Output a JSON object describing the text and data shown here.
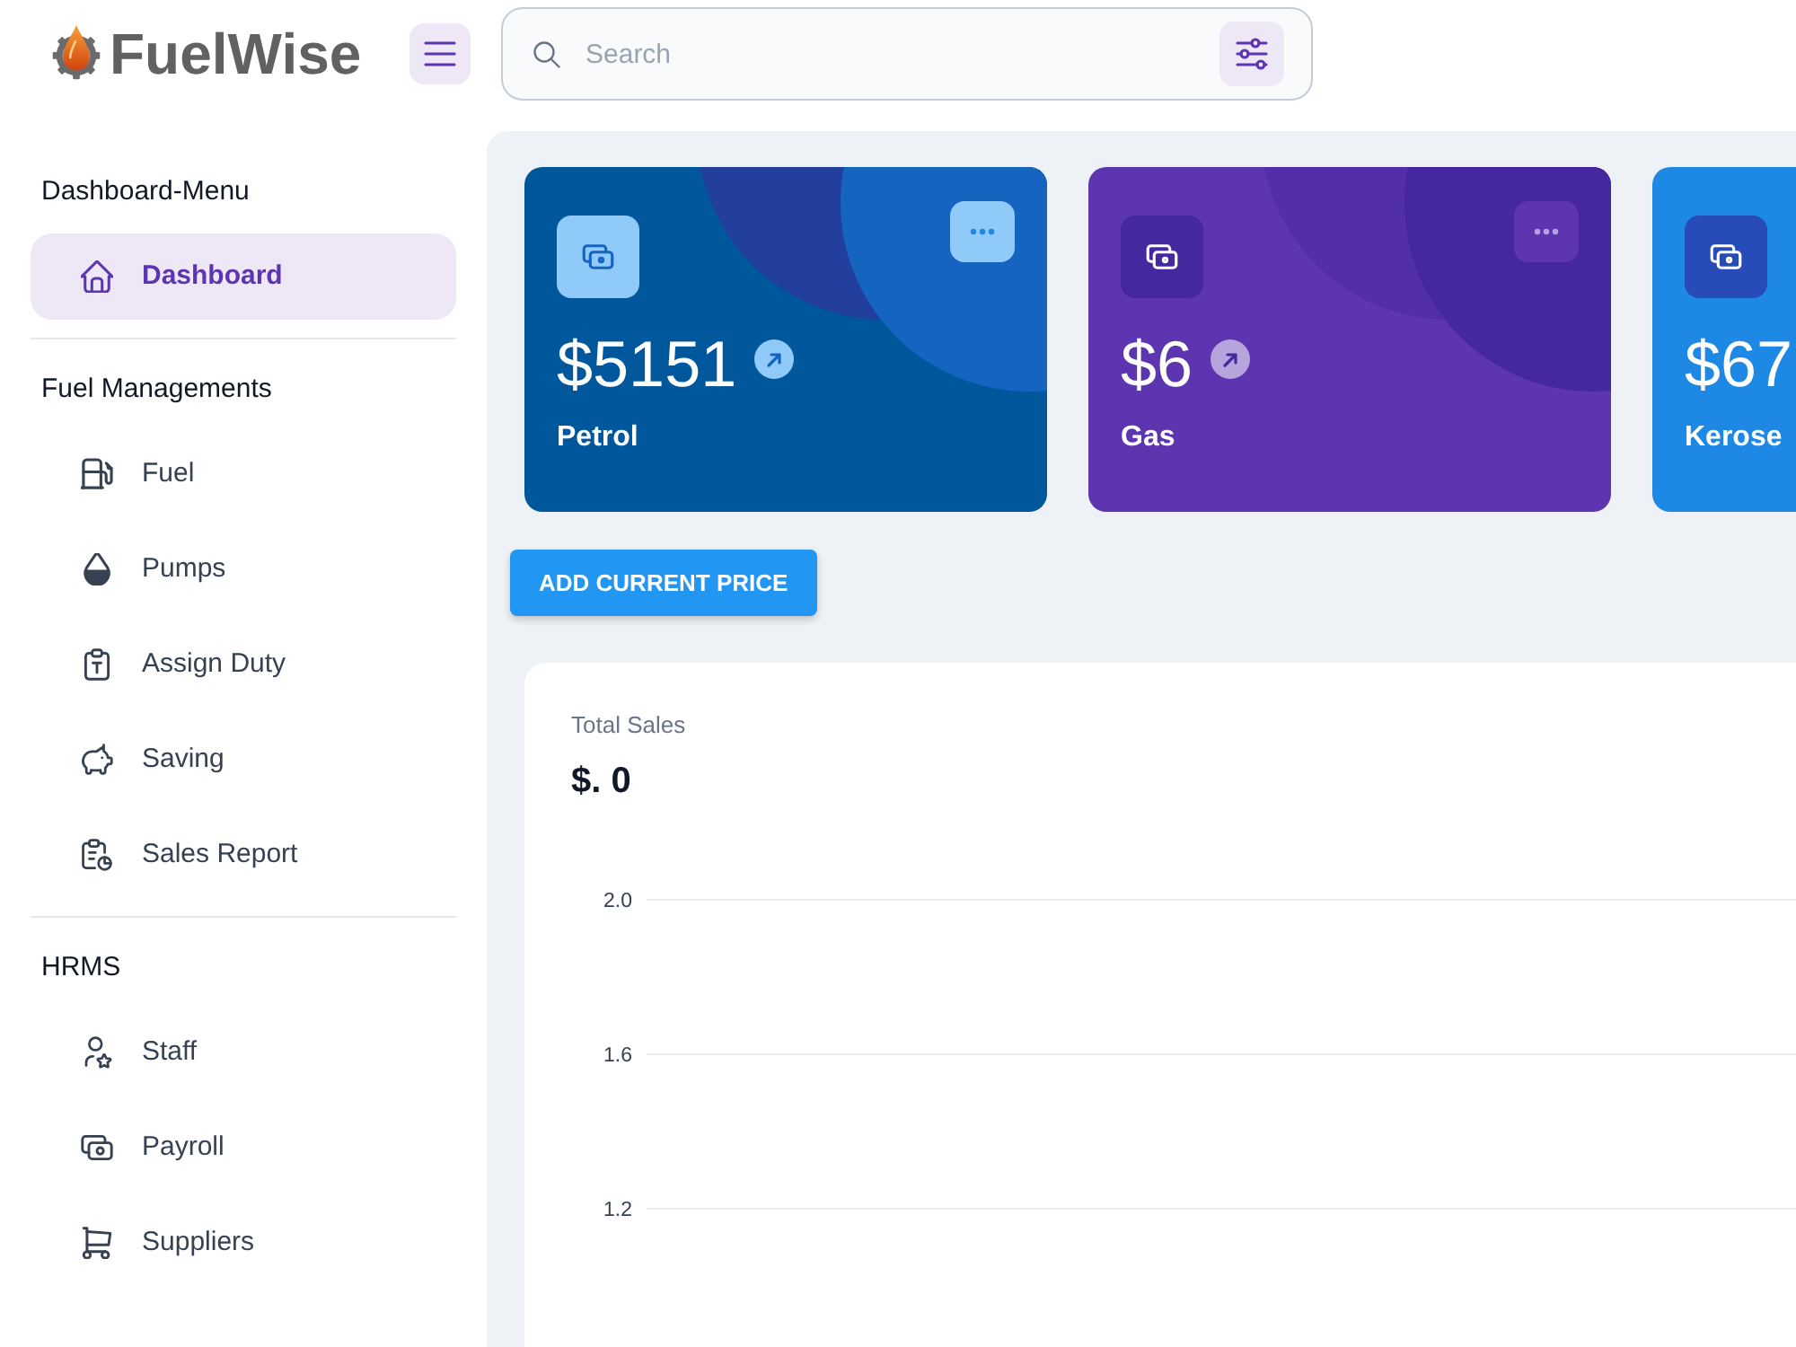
{
  "header": {
    "brand": "FuelWise",
    "search": {
      "placeholder": "Search"
    }
  },
  "sidebar": {
    "sections": [
      {
        "title": "Dashboard-Menu",
        "items": [
          {
            "label": "Dashboard",
            "selected": true
          }
        ]
      },
      {
        "title": "Fuel Managements",
        "items": [
          {
            "label": "Fuel",
            "selected": false
          },
          {
            "label": "Pumps",
            "selected": false
          },
          {
            "label": "Assign Duty",
            "selected": false
          },
          {
            "label": "Saving",
            "selected": false
          },
          {
            "label": "Sales Report",
            "selected": false
          }
        ]
      },
      {
        "title": "HRMS",
        "items": [
          {
            "label": "Staff",
            "selected": false
          },
          {
            "label": "Payroll",
            "selected": false
          },
          {
            "label": "Suppliers",
            "selected": false
          }
        ]
      }
    ]
  },
  "price_cards": [
    {
      "kind": "light",
      "color": "#01579b",
      "value": "$5151",
      "label": "Petrol"
    },
    {
      "kind": "dark",
      "color": "#5e35b1",
      "value": "$6",
      "label": "Gas"
    },
    {
      "kind": "dark",
      "color": "#1e88e5",
      "value": "$67",
      "label": "Kerose"
    }
  ],
  "add_button": {
    "label": "ADD CURRENT PRICE"
  },
  "sales_card": {
    "title": "Total Sales",
    "total": "$. 0",
    "axis_labels": [
      "2.0",
      "1.6",
      "1.2"
    ]
  }
}
